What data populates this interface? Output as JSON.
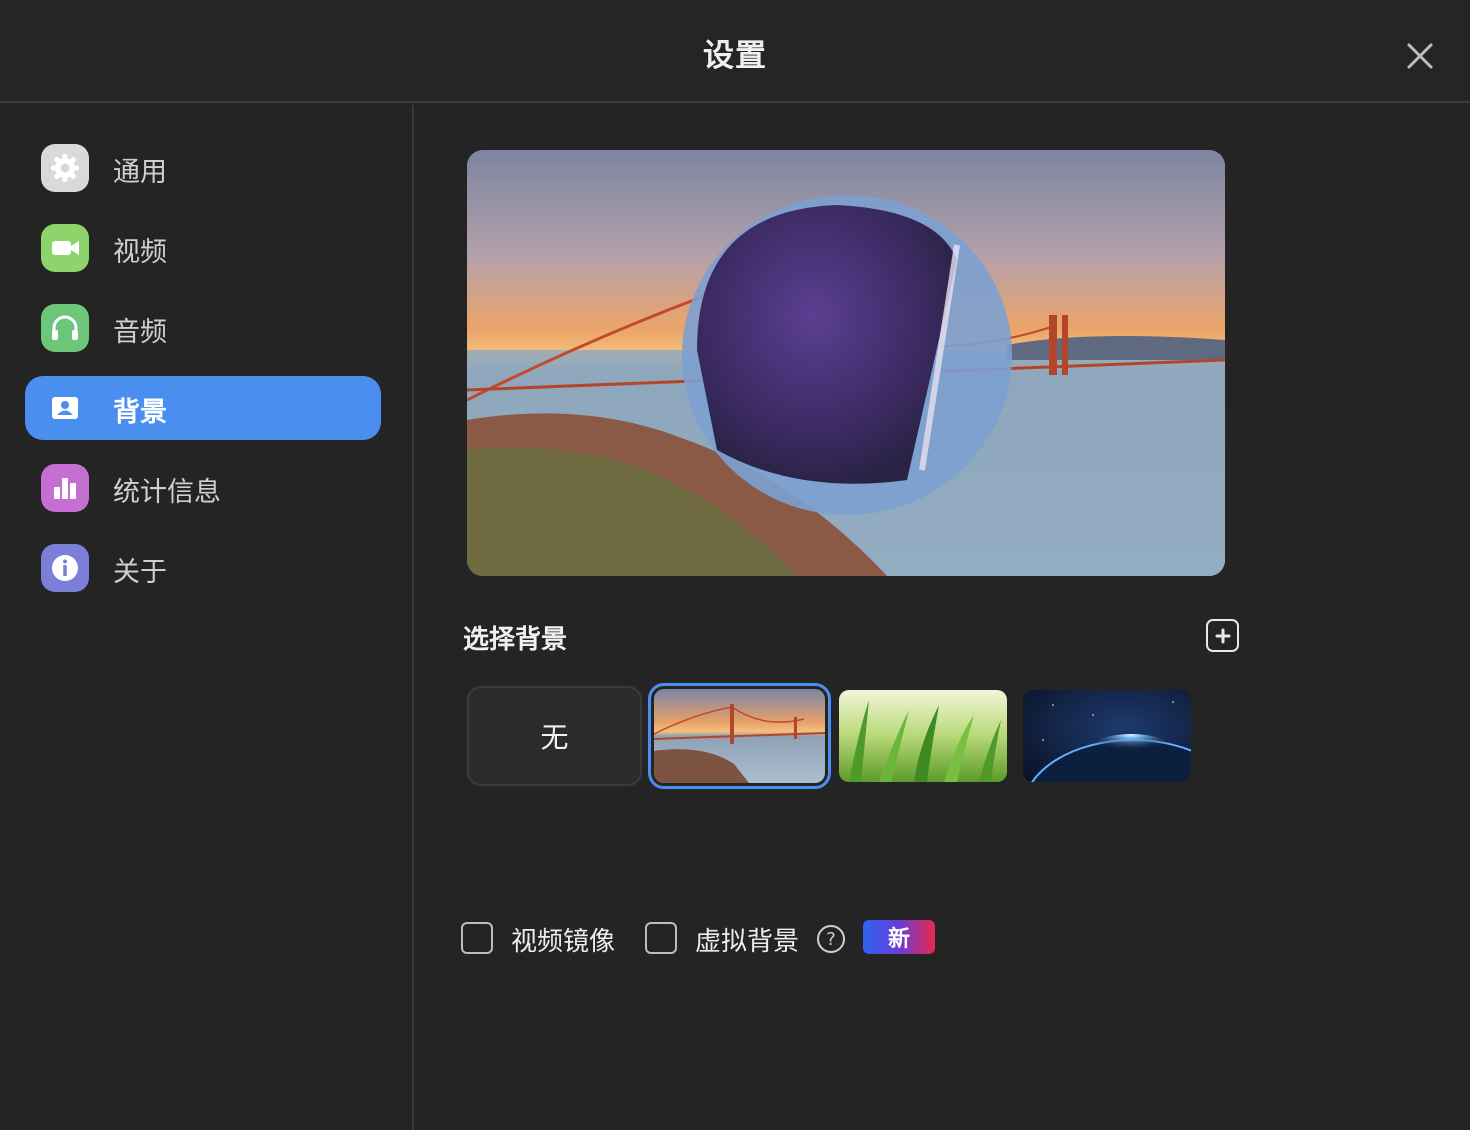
{
  "window": {
    "title": "设置",
    "close_icon": "close-icon"
  },
  "sidebar": {
    "items": [
      {
        "label": "通用",
        "icon": "gear-icon",
        "color": "#d9d9d9",
        "active": false
      },
      {
        "label": "视频",
        "icon": "video-camera-icon",
        "color": "#8dd46a",
        "active": false
      },
      {
        "label": "音频",
        "icon": "headphones-icon",
        "color": "#6cc77a",
        "active": false
      },
      {
        "label": "背景",
        "icon": "portrait-icon",
        "color": "#ffffff",
        "active": true
      },
      {
        "label": "统计信息",
        "icon": "bar-chart-icon",
        "color": "#c56fd3",
        "active": false
      },
      {
        "label": "关于",
        "icon": "info-icon",
        "color": "#7b7fd8",
        "active": false
      }
    ]
  },
  "main": {
    "section_title": "选择背景",
    "add_button_icon": "plus-icon",
    "backgrounds": [
      {
        "label": "无",
        "type": "none",
        "selected": false
      },
      {
        "type": "golden-gate-bridge",
        "selected": true
      },
      {
        "type": "grass",
        "selected": false
      },
      {
        "type": "earth-from-space",
        "selected": false
      }
    ],
    "options": {
      "mirror_label": "视频镜像",
      "mirror_checked": false,
      "virtual_bg_label": "虚拟背景",
      "virtual_bg_checked": false,
      "help_icon": "question-icon",
      "help_glyph": "?",
      "badge": "新"
    }
  },
  "colors": {
    "accent": "#4a8ff0",
    "background": "#242424"
  }
}
